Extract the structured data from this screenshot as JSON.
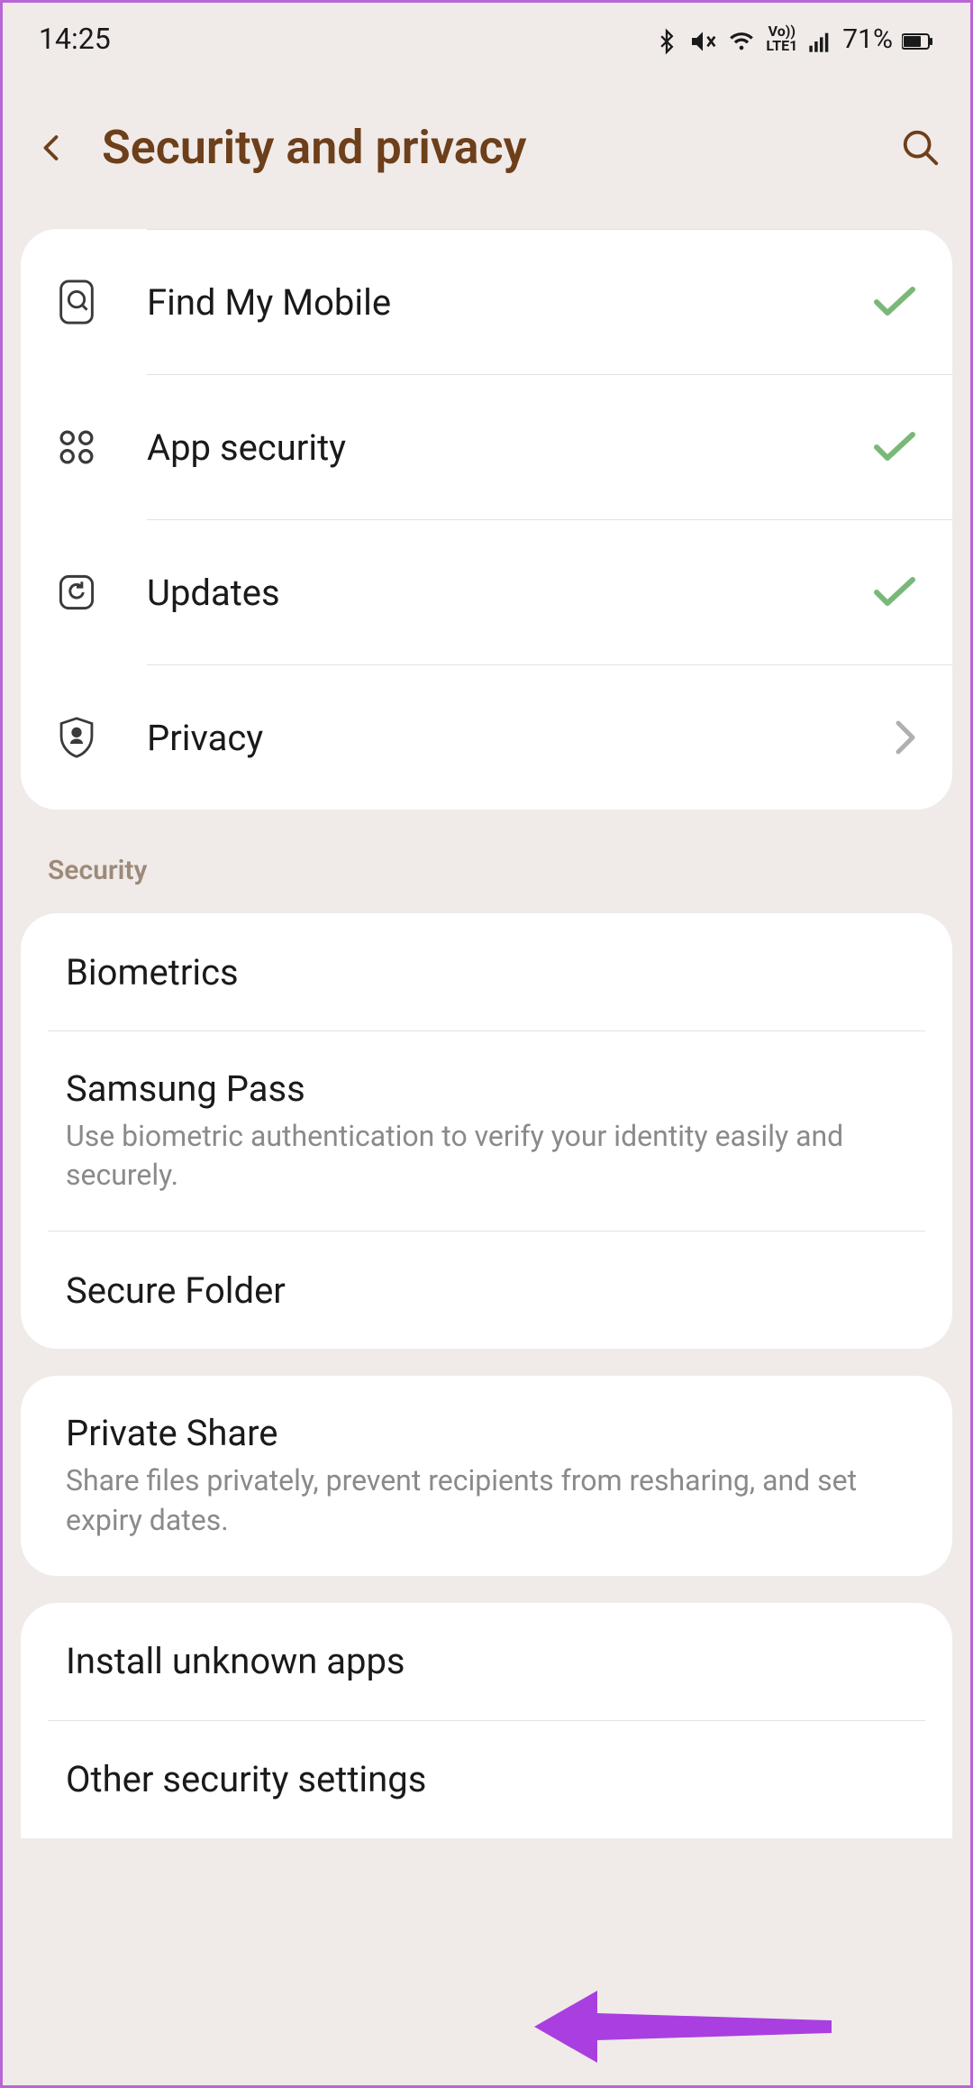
{
  "status": {
    "time": "14:25",
    "battery": "71%",
    "network": "LTE1",
    "volte": "Vo))"
  },
  "header": {
    "title": "Security and privacy"
  },
  "top_items": [
    {
      "label": "Find My Mobile",
      "status": "check"
    },
    {
      "label": "App security",
      "status": "check"
    },
    {
      "label": "Updates",
      "status": "check"
    },
    {
      "label": "Privacy",
      "status": "chevron"
    }
  ],
  "sections": {
    "security_label": "Security"
  },
  "security_items": [
    {
      "title": "Biometrics",
      "subtitle": ""
    },
    {
      "title": "Samsung Pass",
      "subtitle": "Use biometric authentication to verify your identity easily and securely."
    },
    {
      "title": "Secure Folder",
      "subtitle": ""
    }
  ],
  "share_items": [
    {
      "title": "Private Share",
      "subtitle": "Share files privately, prevent recipients from resharing, and set expiry dates."
    }
  ],
  "other_items": [
    {
      "title": "Install unknown apps",
      "subtitle": ""
    },
    {
      "title": "Other security settings",
      "subtitle": ""
    }
  ]
}
